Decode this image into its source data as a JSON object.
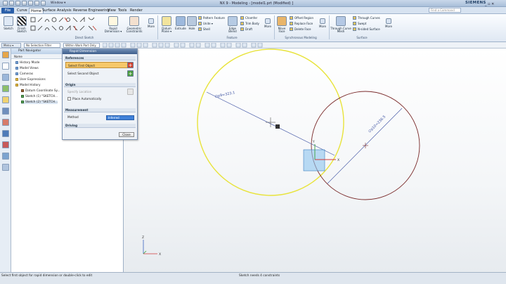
{
  "window": {
    "title": "NX 9 - Modeling - [model1.prt (Modified) ]",
    "window_menu": "Window ▾",
    "brand": "SIEMENS",
    "controls": "_ ▫ ✕"
  },
  "menu": {
    "file": "File",
    "tabs": [
      "Curve",
      "Home",
      "Surface",
      "Analysis",
      "Reverse Engineering",
      "View",
      "Tools",
      "Render"
    ],
    "find_placeholder": "Find a Command"
  },
  "ribbon": {
    "big_buttons": [
      {
        "label": "Sketch",
        "icon": "sketch-icon"
      },
      {
        "label": "Finish Sketch",
        "icon": "finish-sketch-icon"
      },
      {
        "label": "Rapid Dimension ▾",
        "icon": "rapid-dimension-icon"
      },
      {
        "label": "Geometric Constraints",
        "icon": "geometric-constraints-icon"
      },
      {
        "label": "More",
        "icon": "more-icon"
      },
      {
        "label": "Datum Plane ▾",
        "icon": "datum-plane-icon"
      },
      {
        "label": "Extrude",
        "icon": "extrude-icon"
      },
      {
        "label": "Hole",
        "icon": "hole-icon"
      },
      {
        "label": "Edge Blend",
        "icon": "edge-blend-icon"
      },
      {
        "label": "More",
        "icon": "more-icon"
      },
      {
        "label": "Move Face",
        "icon": "move-face-icon"
      },
      {
        "label": "More",
        "icon": "more-icon"
      },
      {
        "label": "Through Curve Mesh",
        "icon": "through-curve-mesh-icon"
      },
      {
        "label": "More",
        "icon": "more-icon"
      }
    ],
    "feature_small": [
      "Pattern Feature",
      "Unite ▾",
      "Shell"
    ],
    "feature_small2": [
      "Chamfer",
      "Trim Body",
      "Draft"
    ],
    "sync_small": [
      "Offset Region",
      "Replace Face",
      "Delete Face"
    ],
    "surface_small": [
      "Through Curves",
      "Swept",
      "N-sided Surface"
    ],
    "groups": {
      "direct_sketch": "Direct Sketch",
      "feature": "Feature",
      "sync": "Synchronous Modeling",
      "surface": "Surface"
    }
  },
  "selection_bar": {
    "menu": "Menu ▾",
    "filter": "No Selection Filter",
    "scope": "Within Work Part Only"
  },
  "navigator": {
    "title": "Part Navigator",
    "column": "Name",
    "items": [
      "History Mode",
      "Model Views",
      "Cameras",
      "User Expressions",
      "Model History",
      "Datum Coordinate Sy...",
      "Sketch (1) \"SKETCH...",
      "Sketch (2) \"SKETCH..."
    ]
  },
  "dialog": {
    "title": "Rapid Dimension",
    "references": "References",
    "select_first": "Select First Object",
    "select_second": "Select Second Object",
    "origin": "Origin",
    "specify_location": "Specify Location",
    "place_auto": "Place Automatically",
    "measurement": "Measurement",
    "method_label": "Method",
    "method_value": "Inferred",
    "driving": "Driving",
    "close": "Close"
  },
  "canvas": {
    "dim1": "∅p9=323.1",
    "dim2": "∅p10=236.5",
    "axis_x": "X",
    "axis_y": "Y",
    "axis_z": "Z"
  },
  "status": {
    "left": "Select first object for rapid dimension or double-click to edit",
    "right": "Sketch needs 4 constraints"
  },
  "colors": {
    "accent": "#2a5fa9",
    "yellow_circle": "#e8e33a",
    "red_circle": "#7a2a2a",
    "dim_line": "#3a4fa0"
  }
}
